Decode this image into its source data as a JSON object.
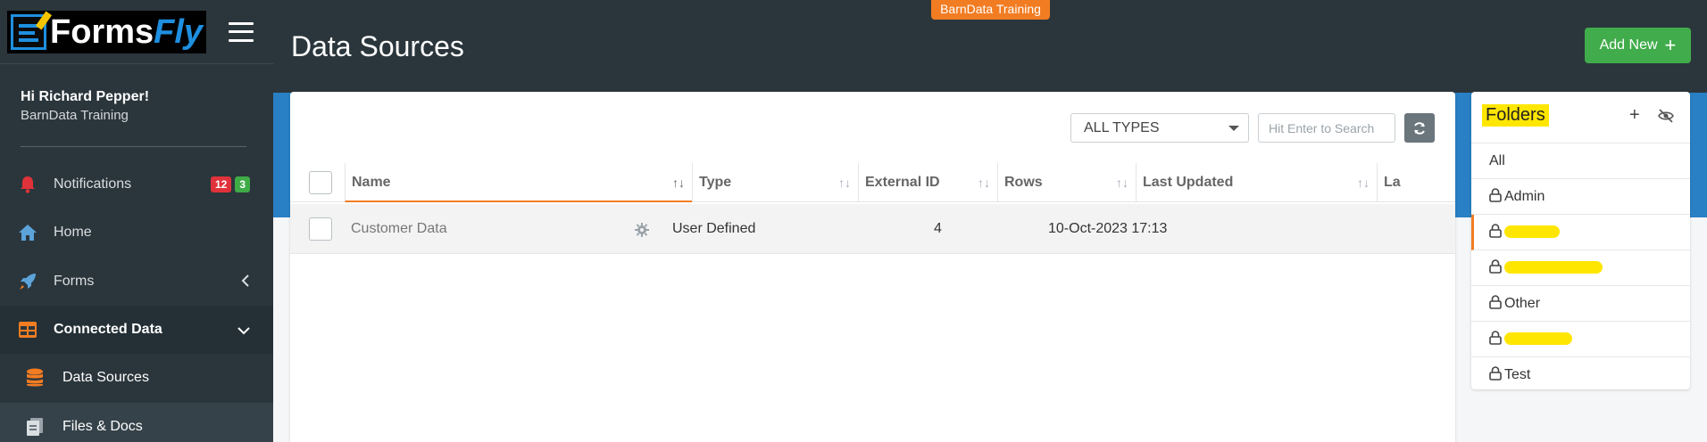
{
  "app": {
    "logo_forms": "Forms",
    "logo_fly": "Fly",
    "environment": "BarnData Training"
  },
  "user": {
    "greeting": "Hi Richard Pepper!",
    "org": "BarnData Training"
  },
  "nav": {
    "notifications": {
      "label": "Notifications",
      "badge_red": "12",
      "badge_green": "3",
      "icon": "bell-icon"
    },
    "home": {
      "label": "Home",
      "icon": "home-icon"
    },
    "forms": {
      "label": "Forms",
      "icon": "rocket-icon"
    },
    "connected_data": {
      "label": "Connected Data",
      "icon": "table-icon"
    },
    "data_sources": {
      "label": "Data Sources",
      "icon": "database-icon"
    },
    "files_docs": {
      "label": "Files & Docs",
      "icon": "file-icon"
    }
  },
  "header": {
    "title": "Data Sources",
    "add_new_label": "Add New"
  },
  "toolbar": {
    "type_filter": "ALL TYPES",
    "search_placeholder": "Hit Enter to Search"
  },
  "table": {
    "columns": [
      "Name",
      "Type",
      "External ID",
      "Rows",
      "Last Updated",
      "La"
    ],
    "rows": [
      {
        "name": "Customer Data",
        "type": "User Defined",
        "external_id": "",
        "rows": "4",
        "last_updated": "10-Oct-2023 17:13"
      }
    ]
  },
  "folders": {
    "title": "Folders",
    "items": [
      "All",
      "Admin",
      "",
      "",
      "Other",
      "",
      "Test"
    ]
  },
  "colors": {
    "sidebar_bg": "#2b363c",
    "accent_orange": "#f27c22",
    "add_green": "#41ac4b",
    "band_blue": "#2980c4",
    "highlight_yellow": "#ffe600"
  }
}
